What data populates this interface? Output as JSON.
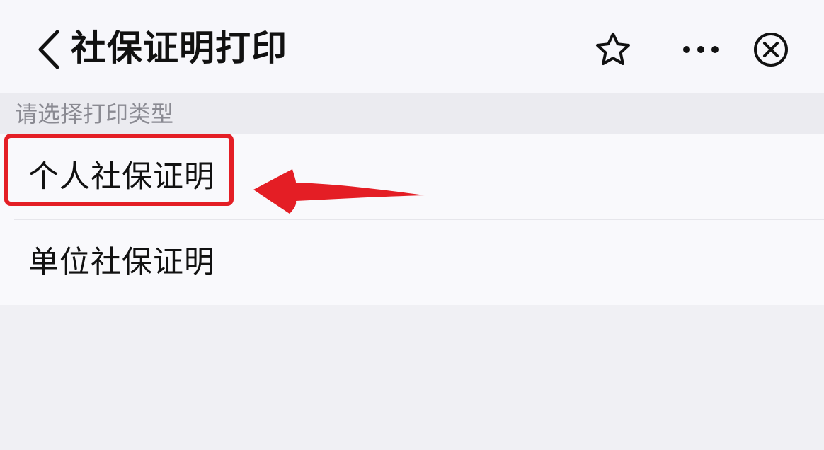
{
  "header": {
    "title": "社保证明打印",
    "back_icon": "chevron-left-icon",
    "favorite_icon": "star-icon",
    "more_icon": "ellipsis-icon",
    "close_icon": "close-circle-icon"
  },
  "section": {
    "label": "请选择打印类型"
  },
  "options": [
    {
      "label": "个人社保证明",
      "highlighted": true
    },
    {
      "label": "单位社保证明",
      "highlighted": false
    }
  ],
  "annotation": {
    "color": "#e41e25",
    "target": "options.0"
  },
  "colors": {
    "background": "#f0f0f4",
    "surface": "#f9f9fc",
    "text": "#111111",
    "muted_text": "#8a8a92"
  }
}
